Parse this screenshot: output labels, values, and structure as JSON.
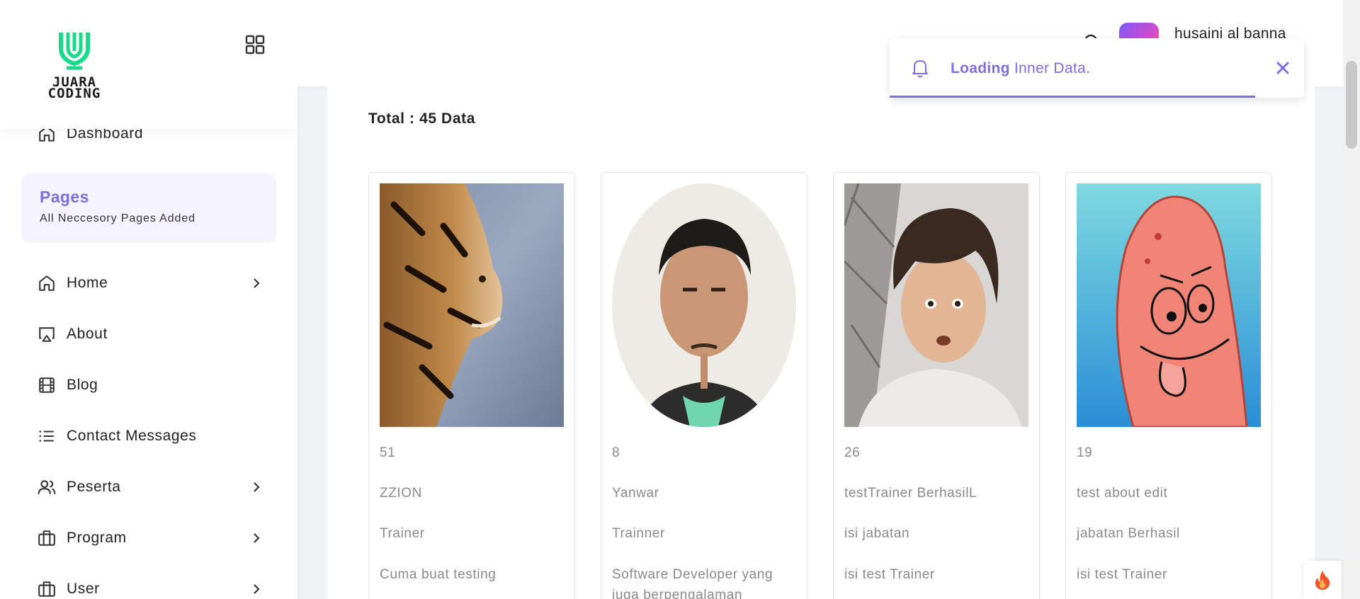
{
  "brand": {
    "logo_text_line1": "JUARA",
    "logo_text_line2": "CODING",
    "accent": "#7d70e3",
    "logo_green": "#19d98b"
  },
  "sidebar": {
    "dashboard_label": "Dashboard",
    "pages_title": "Pages",
    "pages_subtitle": "All Neccesory Pages Added",
    "items": [
      {
        "label": "Home",
        "icon": "home-icon",
        "has_chevron": true
      },
      {
        "label": "About",
        "icon": "airplay-icon",
        "has_chevron": false
      },
      {
        "label": "Blog",
        "icon": "film-icon",
        "has_chevron": false
      },
      {
        "label": "Contact Messages",
        "icon": "list-icon",
        "has_chevron": false
      },
      {
        "label": "Peserta",
        "icon": "users-icon",
        "has_chevron": true
      },
      {
        "label": "Program",
        "icon": "briefcase-icon",
        "has_chevron": true
      },
      {
        "label": "User",
        "icon": "briefcase-icon",
        "has_chevron": true
      }
    ]
  },
  "header": {
    "username": "husaini al banna"
  },
  "toast": {
    "strong": "Loading",
    "message": " Inner Data."
  },
  "content": {
    "total_label": "Total : 45 Data",
    "cards": [
      {
        "id": "51",
        "name": "ZZION",
        "role": "Trainer",
        "desc": "Cuma buat testing",
        "image": "tiger-photo"
      },
      {
        "id": "8",
        "name": "Yanwar",
        "role": "Trainner",
        "desc": "Software Developer yang juga berpengalaman",
        "image": "man-portrait-photo"
      },
      {
        "id": "26",
        "name": "testTrainer BerhasilL",
        "role": "isi jabatan",
        "desc": "isi test Trainer",
        "image": "man-surprised-photo"
      },
      {
        "id": "19",
        "name": "test about edit",
        "role": "jabatan Berhasil",
        "desc": "isi test Trainer",
        "image": "patrick-cartoon"
      }
    ]
  }
}
